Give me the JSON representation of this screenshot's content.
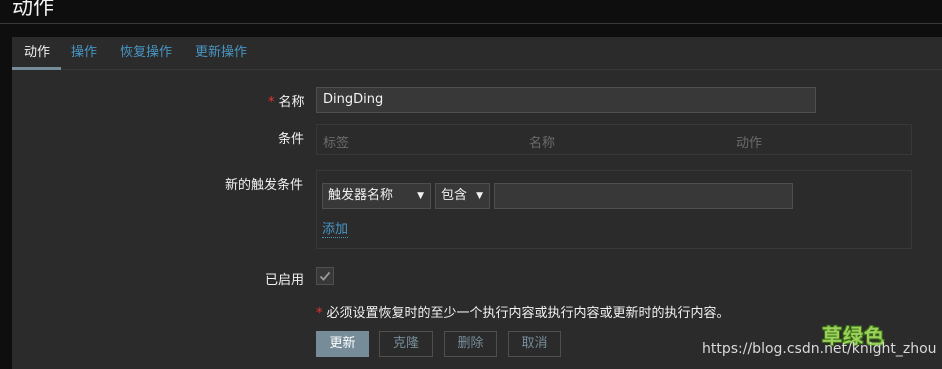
{
  "page": {
    "title": "动作"
  },
  "tabs": [
    {
      "label": "动作",
      "active": true
    },
    {
      "label": "操作",
      "active": false
    },
    {
      "label": "恢复操作",
      "active": false
    },
    {
      "label": "更新操作",
      "active": false
    }
  ],
  "form": {
    "name": {
      "required_mark": "*",
      "label": "名称",
      "value": "DingDing"
    },
    "conditions": {
      "label": "条件",
      "columns": [
        "标签",
        "名称",
        "动作"
      ]
    },
    "new_condition": {
      "label": "新的触发条件",
      "type_select": "触发器名称",
      "operator_select": "包含",
      "value": "",
      "add_link": "添加"
    },
    "enabled": {
      "label": "已启用",
      "checked": true
    },
    "warning": {
      "mark": "*",
      "text": "必须设置恢复时的至少一个执行内容或执行内容或更新时的执行内容。"
    },
    "buttons": {
      "update": "更新",
      "clone": "克隆",
      "delete": "删除",
      "cancel": "取消"
    }
  },
  "watermark": {
    "logo": "草绿色",
    "url": "https://blog.csdn.net/knight_zhou"
  },
  "colors": {
    "background": "#0e0e0e",
    "panel": "#2b2b2b",
    "link": "#4796c4",
    "primary_button": "#768d99",
    "required": "#e33734"
  }
}
